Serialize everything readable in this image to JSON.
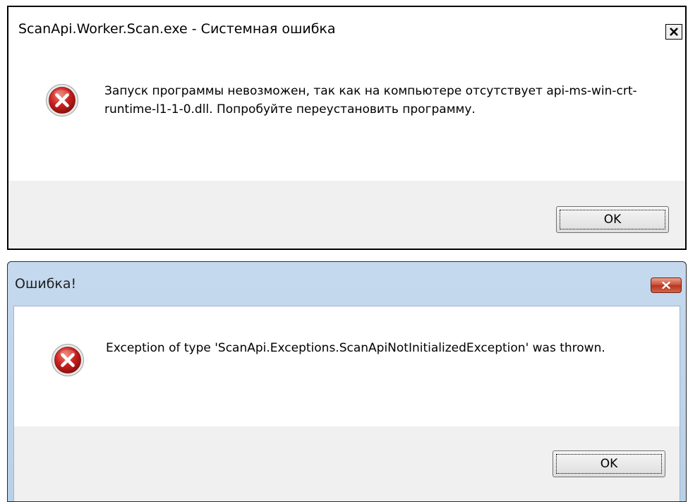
{
  "dialogs": [
    {
      "title": "ScanApi.Worker.Scan.exe - Системная ошибка",
      "icon": "error-icon",
      "message": "Запуск программы невозможен, так как на компьютере отсутствует api-ms-win-crt-runtime-l1-1-0.dll. Попробуйте переустановить программу.",
      "ok_label": "OK"
    },
    {
      "title": "Ошибка!",
      "icon": "error-icon",
      "message": "Exception of type 'ScanApi.Exceptions.ScanApiNotInitializedException' was thrown.",
      "ok_label": "OK"
    }
  ],
  "colors": {
    "error_red": "#c8201e",
    "aero_title": "#c5d9ee",
    "footer_gray": "#f0f0f0"
  }
}
